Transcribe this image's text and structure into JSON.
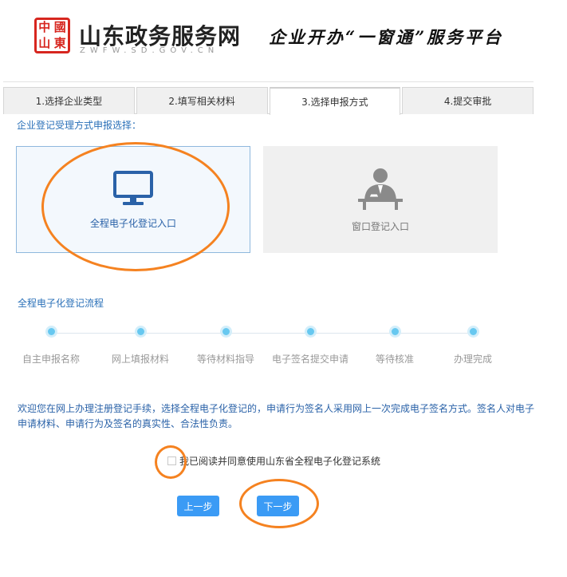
{
  "header": {
    "seal_chars": [
      "中",
      "國",
      "山",
      "東"
    ],
    "site_title": "山东政务服务网",
    "site_url": "ZWFW.SD.GOV.CN",
    "platform_title": "企业开办“一窗通”服务平台"
  },
  "tabs": [
    {
      "label": "1.选择企业类型",
      "active": false
    },
    {
      "label": "2.填写相关材料",
      "active": false
    },
    {
      "label": "3.选择申报方式",
      "active": true
    },
    {
      "label": "4.提交审批",
      "active": false
    }
  ],
  "prompt_label": "企业登记受理方式申报选择：",
  "options": {
    "online": {
      "label": "全程电子化登记入口",
      "icon": "monitor-icon",
      "selected": true
    },
    "window": {
      "label": "窗口登记入口",
      "icon": "person-at-desk-icon",
      "selected": false
    }
  },
  "flow": {
    "title": "全程电子化登记流程",
    "steps": [
      "自主申报名称",
      "网上填报材料",
      "等待材料指导",
      "电子签名提交申请",
      "等待核准",
      "办理完成"
    ]
  },
  "notice": "欢迎您在网上办理注册登记手续，选择全程电子化登记的，申请行为签名人采用网上一次完成电子签名方式。签名人对电子申请材料、申请行为及签名的真实性、合法性负责。",
  "agreement": {
    "text": "我已阅读并同意使用山东省全程电子化登记系统",
    "checked": false
  },
  "buttons": {
    "prev": "上一步",
    "next": "下一步"
  },
  "colors": {
    "accent": "#3b9bf5",
    "link_blue": "#2a70b8",
    "seal_red": "#d7261f",
    "annotation": "#f58220",
    "flow_dot": "#67c8f0"
  }
}
